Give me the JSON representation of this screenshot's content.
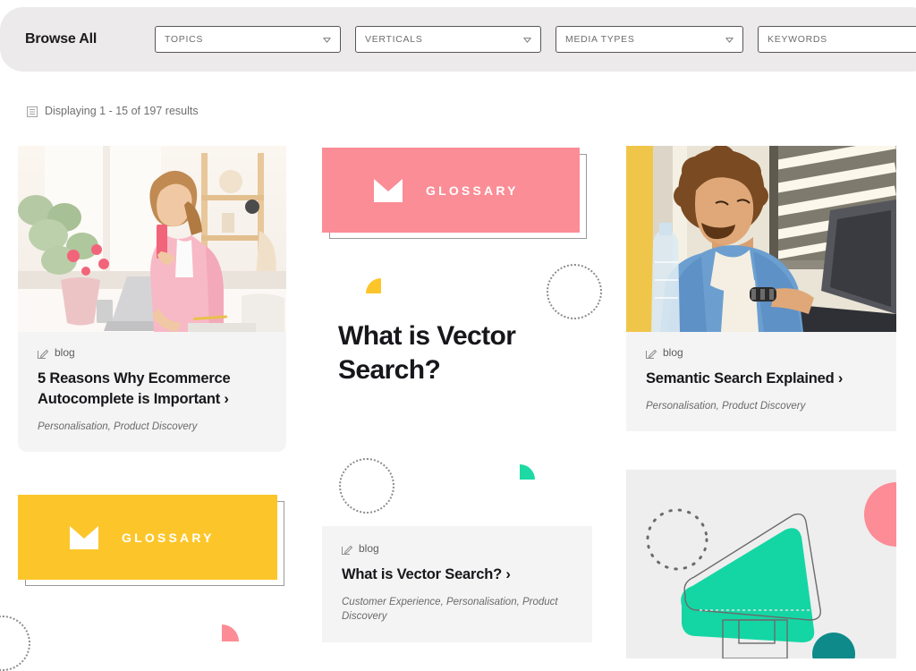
{
  "header": {
    "title": "Browse All",
    "filters": [
      {
        "name": "topics",
        "label": "TOPICS",
        "icon": "chevron-down-icon"
      },
      {
        "name": "verticals",
        "label": "VERTICALS",
        "icon": "chevron-down-icon"
      },
      {
        "name": "mediatypes",
        "label": "MEDIA TYPES",
        "icon": "chevron-down-icon"
      }
    ],
    "keywords": {
      "label": "KEYWORDS",
      "placeholder": "KEYWORDS",
      "value": "",
      "icon": "search-icon"
    },
    "background": "#eceaea"
  },
  "results": {
    "icon": "list-icon",
    "text": "Displaying 1 - 15 of 197 results",
    "range_start": 1,
    "range_end": 15,
    "total": 197
  },
  "cards": [
    {
      "id": "card-1",
      "media": "photo",
      "photo_alt": "Woman in pink shirt working on laptop at a bright desk with flowers",
      "kicker_icon": "pencil-icon",
      "kicker": "blog",
      "title": "5 Reasons Why Ecommerce Autocomplete is Important ›",
      "tags": "Personalisation, Product Discovery"
    },
    {
      "id": "card-2",
      "media": "glossary-banner",
      "banner_color": "#fa8d96",
      "banner_logo": "crown-logo-icon",
      "banner_word": "GLOSSARY",
      "title": "What is Vector Search?"
    },
    {
      "id": "card-3",
      "media": "photo",
      "photo_alt": "Man with curly hair in denim shirt typing on a laptop near window blinds",
      "kicker_icon": "pencil-icon",
      "kicker": "blog",
      "title": "Semantic Search Explained ›",
      "tags": "Personalisation, Product Discovery"
    },
    {
      "id": "card-4",
      "media": "glossary-banner",
      "banner_color": "#fcc62b",
      "banner_logo": "crown-logo-icon",
      "banner_word": "GLOSSARY"
    },
    {
      "id": "card-5",
      "media": "none",
      "kicker_icon": "pencil-icon",
      "kicker": "blog",
      "title": "What is Vector Search? ›",
      "tags": "Customer Experience, Personalisation, Product Discovery"
    },
    {
      "id": "card-6",
      "media": "graphic",
      "graphic_alt": "Abstract teal megaphone triangle with pink circle and dotted circle"
    }
  ],
  "colors": {
    "pink": "#fa8d96",
    "yellow": "#fcc62b",
    "teal": "#1ed9a4",
    "dark_teal": "#0e8a8a",
    "text_dark": "#17171b",
    "text_muted": "#6a6a6a",
    "card_bg": "#f4f4f4",
    "header_bg": "#eceaea"
  }
}
